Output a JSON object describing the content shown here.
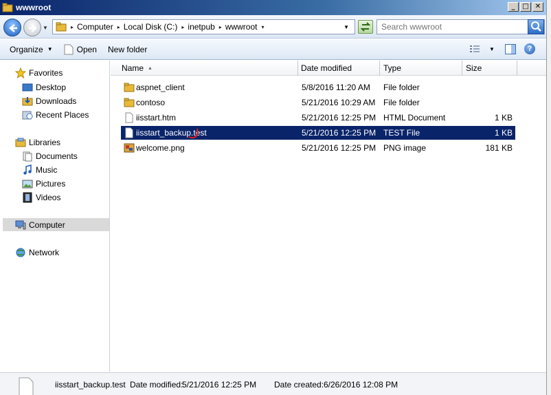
{
  "window": {
    "title": "wwwroot",
    "controls": [
      "_",
      "□",
      "✕"
    ]
  },
  "address": {
    "crumbs": [
      "Computer",
      "Local Disk (C:)",
      "inetpub",
      "wwwroot"
    ],
    "search_placeholder": "Search wwwroot"
  },
  "toolbar": {
    "organize_label": "Organize",
    "open_label": "Open",
    "new_folder_label": "New folder",
    "help_label": "?"
  },
  "nav": {
    "favorites": {
      "label": "Favorites",
      "items": [
        "Desktop",
        "Downloads",
        "Recent Places"
      ]
    },
    "libraries": {
      "label": "Libraries",
      "items": [
        "Documents",
        "Music",
        "Pictures",
        "Videos"
      ]
    },
    "computer_label": "Computer",
    "network_label": "Network"
  },
  "columns": {
    "name": "Name",
    "date": "Date modified",
    "type": "Type",
    "size": "Size"
  },
  "files": [
    {
      "name": "aspnet_client",
      "date": "5/8/2016 11:20 AM",
      "type": "File folder",
      "size": "",
      "icon": "folder-icon"
    },
    {
      "name": "contoso",
      "date": "5/21/2016 10:29 AM",
      "type": "File folder",
      "size": "",
      "icon": "folder-icon"
    },
    {
      "name": "iisstart.htm",
      "date": "5/21/2016 12:25 PM",
      "type": "HTML Document",
      "size": "1 KB",
      "icon": "html-file-icon"
    },
    {
      "name": "iisstart_backup.test",
      "date": "5/21/2016 12:25 PM",
      "type": "TEST File",
      "size": "1 KB",
      "icon": "file-icon",
      "selected": true
    },
    {
      "name": "welcome.png",
      "date": "5/21/2016 12:25 PM",
      "type": "PNG image",
      "size": "181 KB",
      "icon": "image-file-icon"
    }
  ],
  "details": {
    "filename": "iisstart_backup.test",
    "modified_label": "Date modified:",
    "modified_value": "5/21/2016 12:25 PM",
    "created_label": "Date created:",
    "created_value": "6/26/2016 12:08 PM"
  },
  "colors": {
    "selection": "#0a246a",
    "title_start": "#0a246a",
    "folder": "#e8b93a",
    "annotation_mark": "#e02020"
  }
}
